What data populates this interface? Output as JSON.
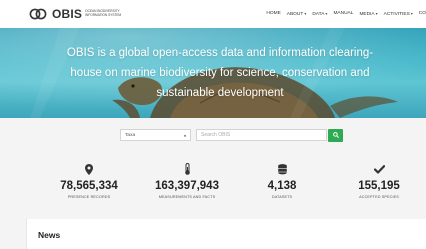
{
  "header": {
    "logo_text": "OBIS",
    "logo_subtext": "Ocean Biodiversity Information System",
    "nav": [
      {
        "label": "HOME",
        "dropdown": false
      },
      {
        "label": "ABOUT",
        "dropdown": true
      },
      {
        "label": "DATA",
        "dropdown": true
      },
      {
        "label": "MANUAL",
        "dropdown": false
      },
      {
        "label": "MEDIA",
        "dropdown": true
      },
      {
        "label": "ACTIVITIES",
        "dropdown": true
      },
      {
        "label": "CO",
        "dropdown": false
      }
    ]
  },
  "hero": {
    "tagline": "OBIS is a global open-access data and information clearing-house on marine biodiversity for science, conservation and sustainable development"
  },
  "search": {
    "selected": "Taxa",
    "placeholder": "Search OBIS",
    "button_icon": "search-icon"
  },
  "stats": [
    {
      "icon": "map-marker-icon",
      "value": "78,565,334",
      "label": "PRESENCE RECORDS"
    },
    {
      "icon": "thermometer-icon",
      "value": "163,397,943",
      "label": "MEASUREMENTS AND FACTS"
    },
    {
      "icon": "database-icon",
      "value": "4,138",
      "label": "DATASETS"
    },
    {
      "icon": "checkmark-icon",
      "value": "155,195",
      "label": "ACCEPTED SPECIES"
    }
  ],
  "news": {
    "title": "News"
  },
  "colors": {
    "accent_green": "#2eaa52",
    "hero_teal": "#44b7c9"
  }
}
